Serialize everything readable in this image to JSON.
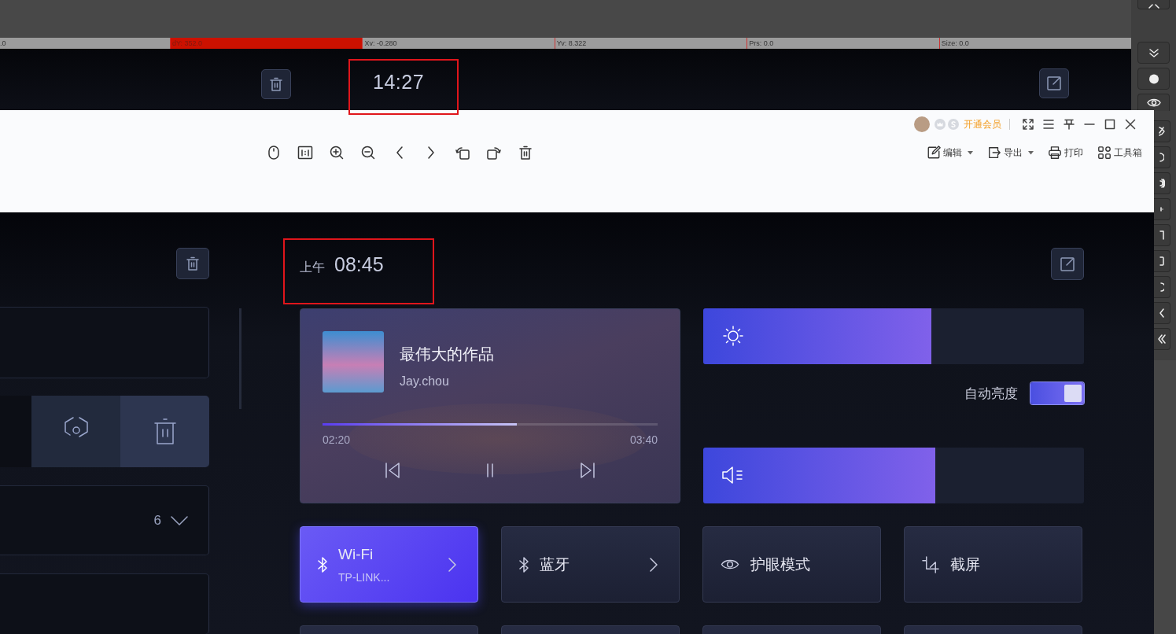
{
  "status_bar": {
    "segments": [
      {
        "text": ".0",
        "highlighted": false
      },
      {
        "text": "dY: 352.0",
        "highlighted": true
      },
      {
        "text": "Xv: -0.280",
        "highlighted": false
      },
      {
        "text": "Yv: 8.322",
        "highlighted": false
      },
      {
        "text": "Prs: 0.0",
        "highlighted": false
      },
      {
        "text": "Size: 0.0",
        "highlighted": false
      }
    ]
  },
  "background_app": {
    "time": "14:27",
    "time_highlighted": true
  },
  "viewer": {
    "vip_label": "开通会员",
    "actions": [
      {
        "kind": "edit",
        "label": "编辑",
        "has_menu": true
      },
      {
        "kind": "export",
        "label": "导出",
        "has_menu": true
      },
      {
        "kind": "print",
        "label": "打印",
        "has_menu": false
      },
      {
        "kind": "toolbox",
        "label": "工具箱",
        "has_menu": false
      }
    ]
  },
  "app": {
    "am_pm": "上午",
    "time": "08:45",
    "time_highlighted": true,
    "left_panel": {
      "count": "6"
    },
    "music": {
      "title": "最伟大的作品",
      "artist": "Jay.chou",
      "elapsed": "02:20",
      "duration": "03:40",
      "level": 0.58,
      "playing": true
    },
    "brightness": {
      "level": 0.6
    },
    "auto_brightness": {
      "label": "自动亮度",
      "on": true
    },
    "volume": {
      "level": 0.61
    },
    "tiles": [
      {
        "kind": "wifi",
        "title": "Wi-Fi",
        "subtitle": "TP-LINK...",
        "on": true,
        "has_arrow": true
      },
      {
        "kind": "bluetooth",
        "title": "蓝牙",
        "on": false,
        "has_arrow": true
      },
      {
        "kind": "eye",
        "title": "护眼模式",
        "on": false,
        "has_arrow": false
      },
      {
        "kind": "crop",
        "title": "截屏",
        "on": false,
        "has_arrow": false
      }
    ]
  }
}
